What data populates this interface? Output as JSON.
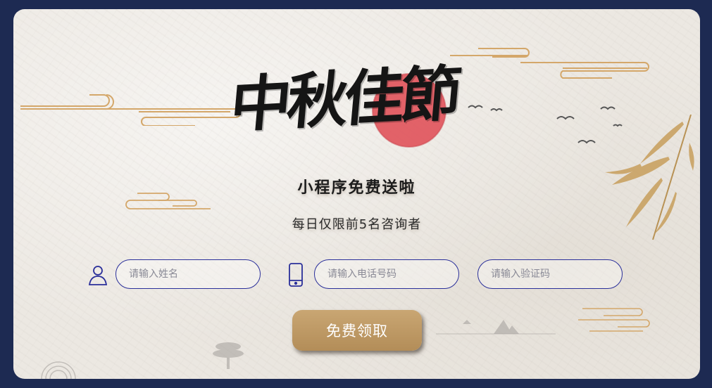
{
  "title_art": "中秋佳節",
  "subtitle": "小程序免费送啦",
  "tagline": "每日仅限前5名咨询者",
  "form": {
    "name": {
      "placeholder": "请输入姓名",
      "icon": "user-icon"
    },
    "phone": {
      "placeholder": "请输入电话号码",
      "icon": "phone-icon"
    },
    "code": {
      "placeholder": "请输入验证码"
    }
  },
  "submit_label": "免费领取",
  "colors": {
    "frame": "#1d2a52",
    "paper": "#ece8e2",
    "accent_gold": "#c9a673",
    "input_border": "#2a2f9a",
    "moon_red": "#e0525a"
  }
}
